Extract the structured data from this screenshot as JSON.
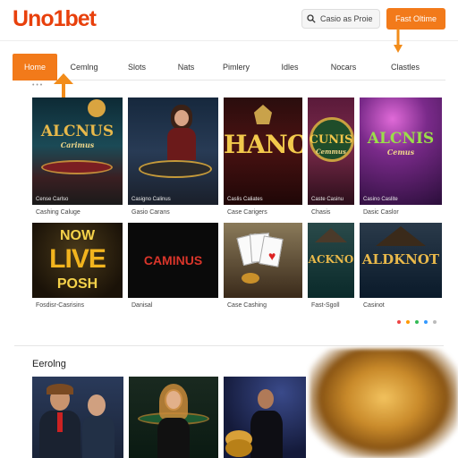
{
  "header": {
    "logo_text": "Uno1bet",
    "search_placeholder": "Casio as Proie",
    "cta_label": "Fast Oltime"
  },
  "nav": {
    "items": [
      {
        "label": "Home",
        "active": true
      },
      {
        "label": "Cemlng",
        "active": false
      },
      {
        "label": "Slots",
        "active": false
      },
      {
        "label": "Nats",
        "active": false
      },
      {
        "label": "Pimlery",
        "active": false
      },
      {
        "label": "Idles",
        "active": false
      },
      {
        "label": "Nocars",
        "active": false
      },
      {
        "label": "Clastles",
        "active": false
      }
    ],
    "breadcrumb": "• • •"
  },
  "row1": [
    {
      "title": "ALCNUS",
      "subtitle": "Carimus",
      "caption": "Cense  Carlso",
      "label": "Cashing Caluge"
    },
    {
      "title": "",
      "subtitle": "",
      "caption": "Casigno Calinus",
      "label": "Gasio Carans"
    },
    {
      "title": "HANO",
      "subtitle": "",
      "caption": "Caslis Caliates",
      "label": "Case Carigers"
    },
    {
      "title": "CUNIS",
      "subtitle": "Cemmus",
      "caption": "Caste Casinu",
      "label": "Chasis"
    },
    {
      "title": "ALCNIS",
      "subtitle": "Cemus",
      "caption": "Casino Caslite",
      "label": "Dasic Caslor"
    }
  ],
  "row2": [
    {
      "title1": "NOW",
      "title2": "LIVE",
      "title3": "POSH",
      "label": "Fosdisr-Casrisins"
    },
    {
      "title": "CAMINUS",
      "label": "Danisal"
    },
    {
      "title": "",
      "label": "Case Cashing"
    },
    {
      "title": "ACKNO",
      "label": "Fast-Sgoll"
    },
    {
      "title": "ALDKNOT",
      "label": "Casinot"
    }
  ],
  "section": {
    "title": "Eerolng"
  },
  "colors": {
    "brand": "#e8400c",
    "accent": "#f27a1a",
    "pager": [
      "#e44",
      "#f90",
      "#3b5",
      "#39f",
      "#bbb"
    ]
  }
}
